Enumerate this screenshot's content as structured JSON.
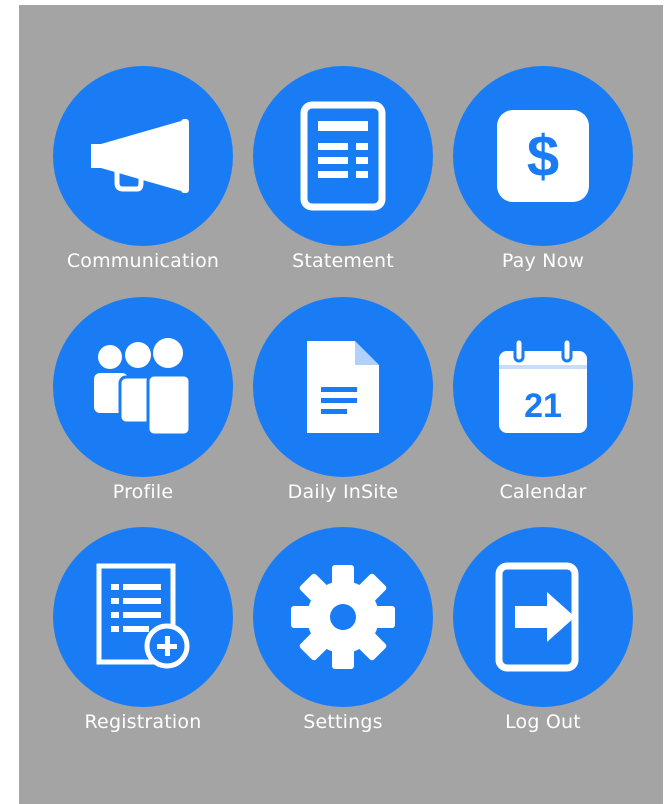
{
  "theme": {
    "background": "#a4a4a4",
    "accent": "#1a7cf4",
    "label_color": "#ffffff"
  },
  "tiles": [
    {
      "label": "Communication",
      "icon": "megaphone-icon"
    },
    {
      "label": "Statement",
      "icon": "statement-icon"
    },
    {
      "label": "Pay Now",
      "icon": "dollar-icon"
    },
    {
      "label": "Profile",
      "icon": "people-icon"
    },
    {
      "label": "Daily InSite",
      "icon": "document-icon"
    },
    {
      "label": "Calendar",
      "icon": "calendar-icon",
      "badge": "21"
    },
    {
      "label": "Registration",
      "icon": "registration-icon"
    },
    {
      "label": "Settings",
      "icon": "gear-icon"
    },
    {
      "label": "Log Out",
      "icon": "logout-icon"
    }
  ]
}
